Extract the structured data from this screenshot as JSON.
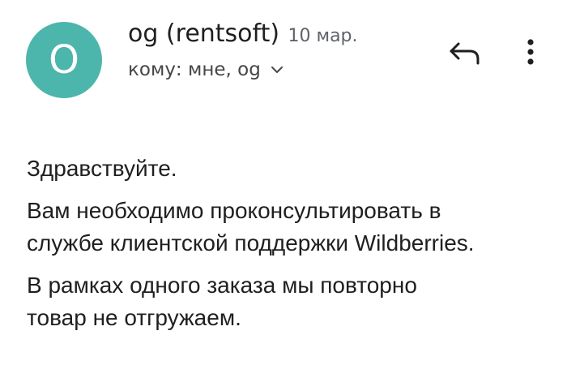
{
  "header": {
    "avatar_letter": "O",
    "avatar_color": "#4db6ac",
    "sender_name": "og (rentsoft)",
    "date": "10 мар.",
    "recipients": "кому: мне, og",
    "icons": {
      "expand": "chevron-down-icon",
      "reply": "reply-icon",
      "more": "more-vert-icon"
    }
  },
  "message": {
    "greeting": "Здравствуйте.",
    "paragraph2_line1": "Вам необходимо проконсультировать в",
    "paragraph2_line2": "службе клиентской поддержки Wildberries.",
    "paragraph3_line1": "В рамках одного заказа мы повторно",
    "paragraph3_line2": "товар не отгружаем."
  }
}
